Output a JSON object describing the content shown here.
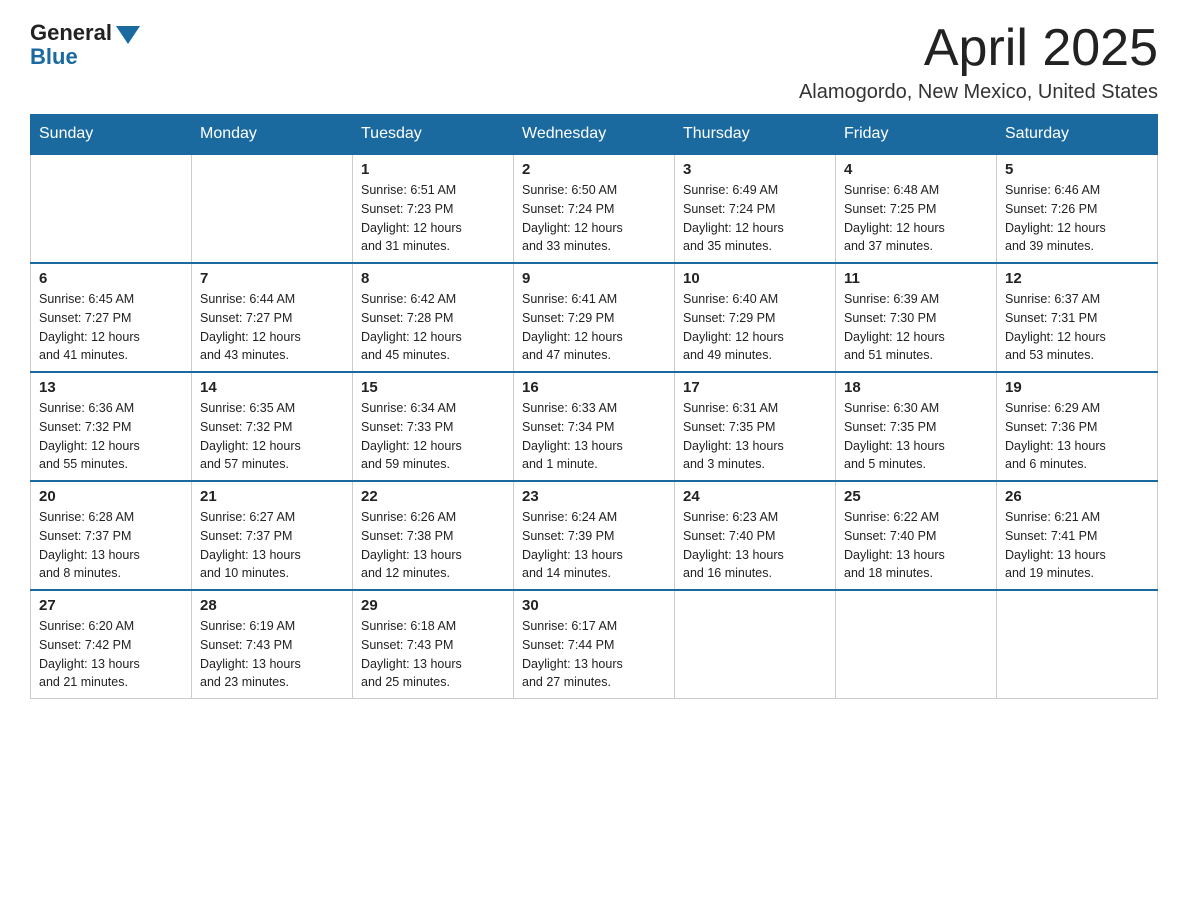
{
  "logo": {
    "general": "General",
    "blue": "Blue"
  },
  "title": {
    "month_year": "April 2025",
    "location": "Alamogordo, New Mexico, United States"
  },
  "headers": [
    "Sunday",
    "Monday",
    "Tuesday",
    "Wednesday",
    "Thursday",
    "Friday",
    "Saturday"
  ],
  "weeks": [
    [
      {
        "day": "",
        "info": ""
      },
      {
        "day": "",
        "info": ""
      },
      {
        "day": "1",
        "info": "Sunrise: 6:51 AM\nSunset: 7:23 PM\nDaylight: 12 hours\nand 31 minutes."
      },
      {
        "day": "2",
        "info": "Sunrise: 6:50 AM\nSunset: 7:24 PM\nDaylight: 12 hours\nand 33 minutes."
      },
      {
        "day": "3",
        "info": "Sunrise: 6:49 AM\nSunset: 7:24 PM\nDaylight: 12 hours\nand 35 minutes."
      },
      {
        "day": "4",
        "info": "Sunrise: 6:48 AM\nSunset: 7:25 PM\nDaylight: 12 hours\nand 37 minutes."
      },
      {
        "day": "5",
        "info": "Sunrise: 6:46 AM\nSunset: 7:26 PM\nDaylight: 12 hours\nand 39 minutes."
      }
    ],
    [
      {
        "day": "6",
        "info": "Sunrise: 6:45 AM\nSunset: 7:27 PM\nDaylight: 12 hours\nand 41 minutes."
      },
      {
        "day": "7",
        "info": "Sunrise: 6:44 AM\nSunset: 7:27 PM\nDaylight: 12 hours\nand 43 minutes."
      },
      {
        "day": "8",
        "info": "Sunrise: 6:42 AM\nSunset: 7:28 PM\nDaylight: 12 hours\nand 45 minutes."
      },
      {
        "day": "9",
        "info": "Sunrise: 6:41 AM\nSunset: 7:29 PM\nDaylight: 12 hours\nand 47 minutes."
      },
      {
        "day": "10",
        "info": "Sunrise: 6:40 AM\nSunset: 7:29 PM\nDaylight: 12 hours\nand 49 minutes."
      },
      {
        "day": "11",
        "info": "Sunrise: 6:39 AM\nSunset: 7:30 PM\nDaylight: 12 hours\nand 51 minutes."
      },
      {
        "day": "12",
        "info": "Sunrise: 6:37 AM\nSunset: 7:31 PM\nDaylight: 12 hours\nand 53 minutes."
      }
    ],
    [
      {
        "day": "13",
        "info": "Sunrise: 6:36 AM\nSunset: 7:32 PM\nDaylight: 12 hours\nand 55 minutes."
      },
      {
        "day": "14",
        "info": "Sunrise: 6:35 AM\nSunset: 7:32 PM\nDaylight: 12 hours\nand 57 minutes."
      },
      {
        "day": "15",
        "info": "Sunrise: 6:34 AM\nSunset: 7:33 PM\nDaylight: 12 hours\nand 59 minutes."
      },
      {
        "day": "16",
        "info": "Sunrise: 6:33 AM\nSunset: 7:34 PM\nDaylight: 13 hours\nand 1 minute."
      },
      {
        "day": "17",
        "info": "Sunrise: 6:31 AM\nSunset: 7:35 PM\nDaylight: 13 hours\nand 3 minutes."
      },
      {
        "day": "18",
        "info": "Sunrise: 6:30 AM\nSunset: 7:35 PM\nDaylight: 13 hours\nand 5 minutes."
      },
      {
        "day": "19",
        "info": "Sunrise: 6:29 AM\nSunset: 7:36 PM\nDaylight: 13 hours\nand 6 minutes."
      }
    ],
    [
      {
        "day": "20",
        "info": "Sunrise: 6:28 AM\nSunset: 7:37 PM\nDaylight: 13 hours\nand 8 minutes."
      },
      {
        "day": "21",
        "info": "Sunrise: 6:27 AM\nSunset: 7:37 PM\nDaylight: 13 hours\nand 10 minutes."
      },
      {
        "day": "22",
        "info": "Sunrise: 6:26 AM\nSunset: 7:38 PM\nDaylight: 13 hours\nand 12 minutes."
      },
      {
        "day": "23",
        "info": "Sunrise: 6:24 AM\nSunset: 7:39 PM\nDaylight: 13 hours\nand 14 minutes."
      },
      {
        "day": "24",
        "info": "Sunrise: 6:23 AM\nSunset: 7:40 PM\nDaylight: 13 hours\nand 16 minutes."
      },
      {
        "day": "25",
        "info": "Sunrise: 6:22 AM\nSunset: 7:40 PM\nDaylight: 13 hours\nand 18 minutes."
      },
      {
        "day": "26",
        "info": "Sunrise: 6:21 AM\nSunset: 7:41 PM\nDaylight: 13 hours\nand 19 minutes."
      }
    ],
    [
      {
        "day": "27",
        "info": "Sunrise: 6:20 AM\nSunset: 7:42 PM\nDaylight: 13 hours\nand 21 minutes."
      },
      {
        "day": "28",
        "info": "Sunrise: 6:19 AM\nSunset: 7:43 PM\nDaylight: 13 hours\nand 23 minutes."
      },
      {
        "day": "29",
        "info": "Sunrise: 6:18 AM\nSunset: 7:43 PM\nDaylight: 13 hours\nand 25 minutes."
      },
      {
        "day": "30",
        "info": "Sunrise: 6:17 AM\nSunset: 7:44 PM\nDaylight: 13 hours\nand 27 minutes."
      },
      {
        "day": "",
        "info": ""
      },
      {
        "day": "",
        "info": ""
      },
      {
        "day": "",
        "info": ""
      }
    ]
  ]
}
